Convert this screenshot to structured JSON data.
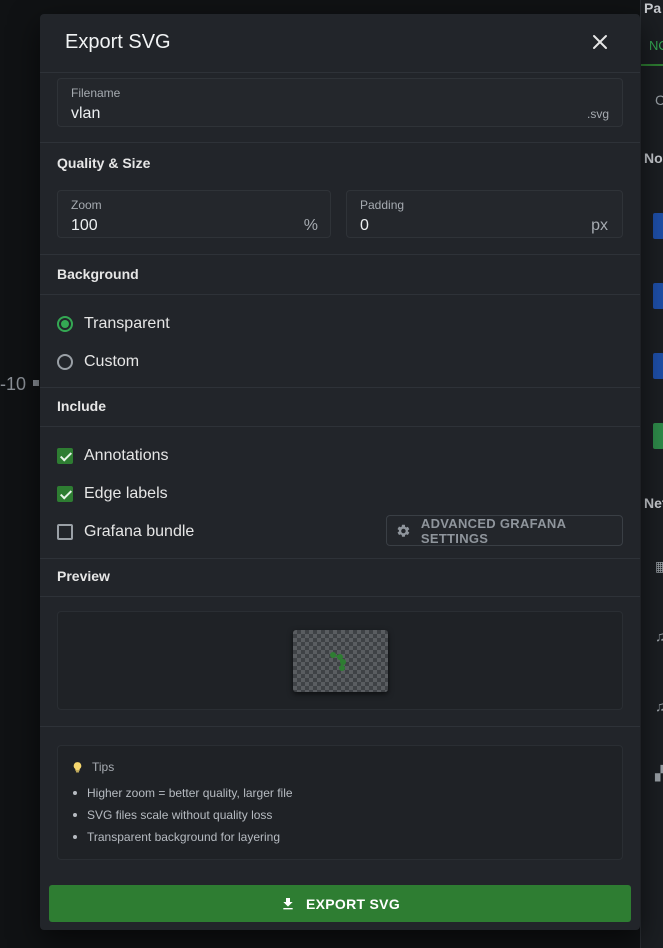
{
  "background_app": {
    "left_axis_label": "-10",
    "right_panel": {
      "title_fragment": "Pa",
      "tab_fragment": "NO",
      "section_fragment_1": "Noc",
      "section_fragment_2": "Net",
      "search_glyph": "C"
    }
  },
  "dialog": {
    "title": "Export SVG",
    "close_icon": "close-icon",
    "filename": {
      "label": "Filename",
      "value": "vlan",
      "suffix": ".svg"
    },
    "quality": {
      "title": "Quality & Size",
      "zoom": {
        "label": "Zoom",
        "value": "100",
        "suffix": "%"
      },
      "padding": {
        "label": "Padding",
        "value": "0",
        "suffix": "px"
      }
    },
    "background": {
      "title": "Background",
      "options": [
        {
          "label": "Transparent",
          "selected": true
        },
        {
          "label": "Custom",
          "selected": false
        }
      ]
    },
    "include": {
      "title": "Include",
      "options": [
        {
          "label": "Annotations",
          "checked": true
        },
        {
          "label": "Edge labels",
          "checked": true
        },
        {
          "label": "Grafana bundle",
          "checked": false
        }
      ],
      "advanced_button": "ADVANCED GRAFANA SETTINGS"
    },
    "preview": {
      "title": "Preview"
    },
    "tips": {
      "title": "Tips",
      "items": [
        "Higher zoom = better quality, larger file",
        "SVG files scale without quality loss",
        "Transparent background for layering"
      ]
    },
    "export_button": "EXPORT SVG"
  },
  "colors": {
    "accent": "#2e7d32",
    "accent_bright": "#34a853",
    "dialog_bg": "#22252a",
    "bulb": "#f5d76e"
  }
}
